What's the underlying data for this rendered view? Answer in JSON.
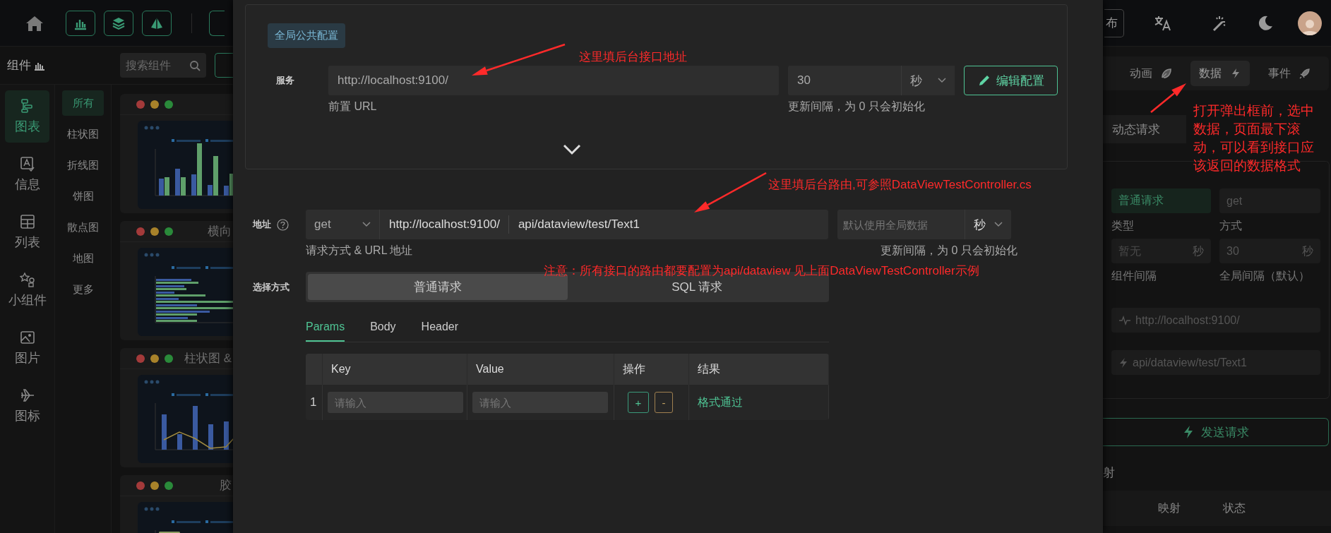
{
  "top_bar": {
    "publish_button": "布"
  },
  "sidebar": {
    "title": "组件",
    "search": {
      "placeholder": "搜索组件"
    },
    "categories": [
      {
        "label": "图表",
        "selected": true
      },
      {
        "label": "信息",
        "selected": false
      },
      {
        "label": "列表",
        "selected": false
      },
      {
        "label": "小组件",
        "selected": false
      },
      {
        "label": "图片",
        "selected": false
      },
      {
        "label": "图标",
        "selected": false
      }
    ],
    "filters": [
      {
        "label": "所有",
        "selected": true
      },
      {
        "label": "柱状图",
        "selected": false
      },
      {
        "label": "折线图",
        "selected": false
      },
      {
        "label": "饼图",
        "selected": false
      },
      {
        "label": "散点图",
        "selected": false
      },
      {
        "label": "地图",
        "selected": false
      },
      {
        "label": "更多",
        "selected": false
      }
    ],
    "components": [
      {
        "kind": "bar"
      },
      {
        "title": "横向",
        "kind": "hbar"
      },
      {
        "title": "柱状图 &",
        "kind": "barline"
      },
      {
        "title": "胶",
        "kind": "capsule"
      }
    ]
  },
  "modal": {
    "global_config": {
      "badge": "全局公共配置",
      "service_label": "服务",
      "base_url": "http://localhost:9100/",
      "base_url_hint": "前置 URL",
      "interval": "30",
      "unit": "秒",
      "interval_hint": "更新间隔，为 0 只会初始化",
      "edit_button": "编辑配置"
    },
    "address": {
      "label": "地址",
      "method": "get",
      "base_url": "http://localhost:9100/",
      "path": "api/dataview/test/Text1",
      "hint": "请求方式 & URL 地址",
      "interval_placeholder": "默认使用全局数据",
      "unit": "秒",
      "interval_hint": "更新间隔，为 0 只会初始化"
    },
    "mode": {
      "label": "选择方式",
      "options": [
        {
          "label": "普通请求",
          "selected": true
        },
        {
          "label": "SQL 请求",
          "selected": false
        }
      ]
    },
    "tabs": [
      {
        "label": "Params",
        "selected": true
      },
      {
        "label": "Body",
        "selected": false
      },
      {
        "label": "Header",
        "selected": false
      }
    ],
    "table": {
      "columns": [
        "Key",
        "Value",
        "操作",
        "结果"
      ],
      "rows": [
        {
          "index": "1",
          "key_placeholder": "请输入",
          "value_placeholder": "请输入",
          "add": "+",
          "remove": "-",
          "result": "格式通过"
        }
      ]
    }
  },
  "right_panel": {
    "tabs": [
      {
        "label": "动画",
        "selected": false
      },
      {
        "label": "数据",
        "selected": true
      },
      {
        "label": "事件",
        "selected": false
      }
    ],
    "source": "动态请求",
    "request_type": "普通请求",
    "method": "get",
    "type_label": "类型",
    "method_label": "方式",
    "component_interval_placeholder": "暂无",
    "unit": "秒",
    "global_interval": "30",
    "global_unit": "秒",
    "component_interval_label": "组件间隔",
    "global_interval_label": "全局间隔（默认）",
    "base_url": "http://localhost:9100/",
    "path": "api/dataview/test/Text1",
    "send_button": "发送请求",
    "section_title": "射",
    "columns": [
      "映射",
      "状态"
    ]
  },
  "annotations": [
    {
      "text": "这里填后台接口地址"
    },
    {
      "text": "这里填后台路由,可参照DataViewTestController.cs"
    },
    {
      "text": "注意：所有接口的路由都要配置为api/dataview 见上面DataViewTestController示例"
    },
    {
      "text": "打开弹出框前，选中数据，页面最下滚动，可以看到接口应该返回的数据格式"
    }
  ]
}
